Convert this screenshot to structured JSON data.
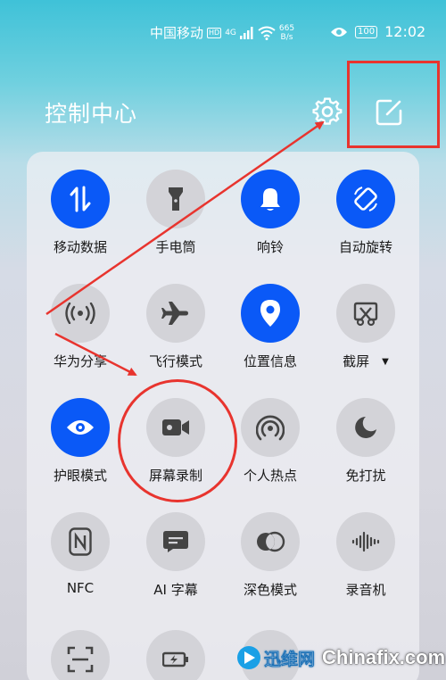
{
  "status_bar": {
    "carrier": "中国移动",
    "hd": "HD",
    "net": "4G",
    "speed_value": "665",
    "speed_unit": "B/s",
    "battery": "100",
    "time": "12:02"
  },
  "header": {
    "title": "控制中心"
  },
  "tiles": [
    {
      "label": "移动数据",
      "icon": "data-arrows-icon",
      "on": true
    },
    {
      "label": "手电筒",
      "icon": "flashlight-icon",
      "on": false
    },
    {
      "label": "响铃",
      "icon": "bell-icon",
      "on": true
    },
    {
      "label": "自动旋转",
      "icon": "rotate-icon",
      "on": true
    },
    {
      "label": "华为分享",
      "icon": "share-waves-icon",
      "on": false
    },
    {
      "label": "飞行模式",
      "icon": "airplane-icon",
      "on": false
    },
    {
      "label": "位置信息",
      "icon": "location-pin-icon",
      "on": true
    },
    {
      "label": "截屏",
      "icon": "scissors-icon",
      "on": false
    },
    {
      "label": "护眼模式",
      "icon": "eye-icon",
      "on": true
    },
    {
      "label": "屏幕录制",
      "icon": "video-camera-icon",
      "on": false
    },
    {
      "label": "个人热点",
      "icon": "hotspot-icon",
      "on": false
    },
    {
      "label": "免打扰",
      "icon": "moon-icon",
      "on": false
    },
    {
      "label": "NFC",
      "icon": "nfc-icon",
      "on": false
    },
    {
      "label": "AI 字幕",
      "icon": "subtitle-icon",
      "on": false
    },
    {
      "label": "深色模式",
      "icon": "dark-mode-icon",
      "on": false
    },
    {
      "label": "录音机",
      "icon": "waveform-icon",
      "on": false
    }
  ],
  "watermark": {
    "brand_cn": "迅维网",
    "brand_en": "Chinafix.com"
  },
  "colors": {
    "accent": "#0a59f7",
    "annotation": "#e8342e"
  }
}
